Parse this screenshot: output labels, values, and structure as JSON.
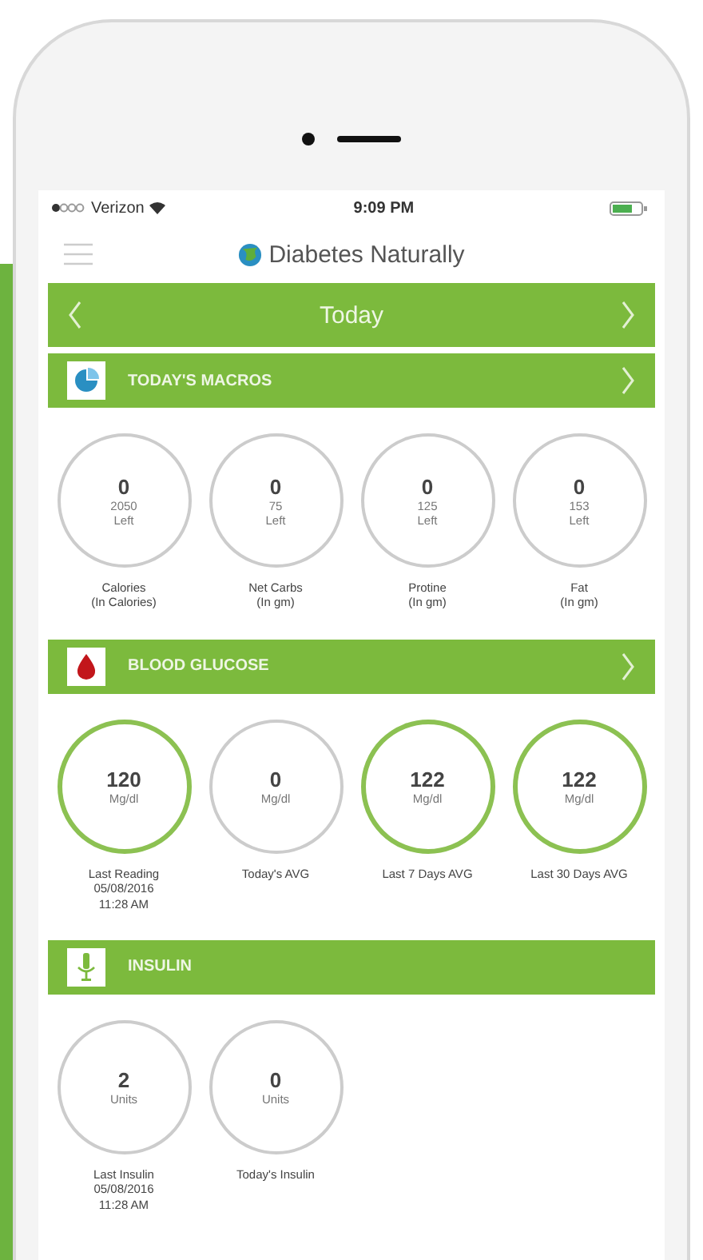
{
  "status_bar": {
    "carrier": "Verizon",
    "time": "9:09 PM"
  },
  "app_header": {
    "title": "Diabetes Naturally"
  },
  "date_bar": {
    "label": "Today"
  },
  "sections": [
    {
      "kind": "macros",
      "title": "TODAY'S MACROS",
      "arrow": true,
      "items": [
        {
          "value": "0",
          "detail": "2050\nLeft",
          "label": "Calories\n(In Calories)",
          "highlighted": false
        },
        {
          "value": "0",
          "detail": "75\nLeft",
          "label": "Net Carbs\n(In gm)",
          "highlighted": false
        },
        {
          "value": "0",
          "detail": "125\nLeft",
          "label": "Protine\n(In gm)",
          "highlighted": false
        },
        {
          "value": "0",
          "detail": "153\nLeft",
          "label": "Fat\n(In gm)",
          "highlighted": false
        }
      ]
    },
    {
      "kind": "glucose",
      "title": "BLOOD GLUCOSE",
      "arrow": true,
      "items": [
        {
          "value": "120",
          "detail": "Mg/dl",
          "label": "Last Reading\n05/08/2016\n11:28 AM",
          "highlighted": true
        },
        {
          "value": "0",
          "detail": "Mg/dl",
          "label": "Today's AVG",
          "highlighted": false
        },
        {
          "value": "122",
          "detail": "Mg/dl",
          "label": "Last 7 Days AVG",
          "highlighted": true
        },
        {
          "value": "122",
          "detail": "Mg/dl",
          "label": "Last 30 Days AVG",
          "highlighted": true
        }
      ]
    },
    {
      "kind": "insulin",
      "title": "INSULIN",
      "arrow": false,
      "items": [
        {
          "value": "2",
          "detail": "Units",
          "label": "Last Insulin\n05/08/2016\n11:28 AM",
          "highlighted": false
        },
        {
          "value": "0",
          "detail": "Units",
          "label": "Today's Insulin",
          "highlighted": false
        }
      ]
    }
  ]
}
